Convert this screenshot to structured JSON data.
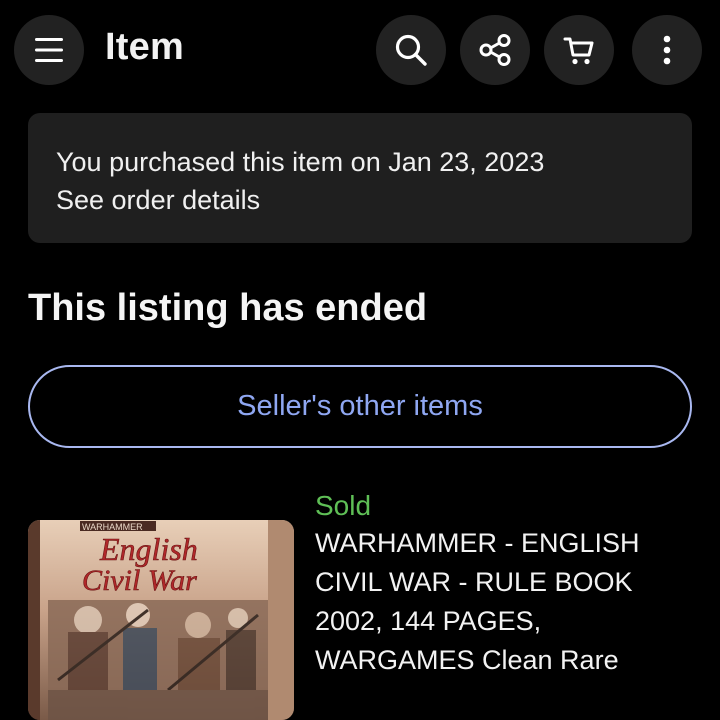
{
  "header": {
    "title": "Item",
    "menu_icon": "hamburger-icon",
    "actions": [
      {
        "name": "search-icon"
      },
      {
        "name": "share-icon"
      },
      {
        "name": "cart-icon"
      },
      {
        "name": "more-vertical-icon"
      }
    ]
  },
  "purchase_banner": {
    "message": "You purchased this item on Jan 23, 2023",
    "link": "See order details"
  },
  "listing_status": "This listing has ended",
  "seller_button": "Seller's other items",
  "item": {
    "status": "Sold",
    "title": "WARHAMMER - ENGLISH CIVIL WAR - RULE BOOK 2002, 144 PAGES, WARGAMES Clean Rare",
    "cover_top_text": "WARHAMMER",
    "cover_title_1": "English",
    "cover_title_2": "Civil War"
  },
  "colors": {
    "background": "#000000",
    "surface": "#1f1f1f",
    "button_circle": "#222222",
    "accent_link": "#8fa7f2",
    "sold_green": "#5fbf56"
  }
}
